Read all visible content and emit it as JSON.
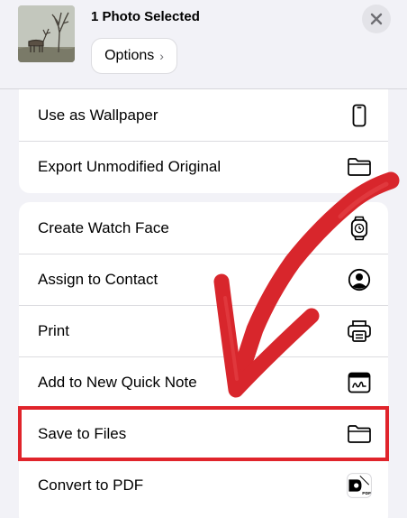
{
  "header": {
    "title": "1 Photo Selected",
    "options_label": "Options",
    "options_chevron": "›"
  },
  "menu_group_1": [
    {
      "label": "Use as Wallpaper",
      "icon": "phone-icon"
    },
    {
      "label": "Export Unmodified Original",
      "icon": "folder-icon"
    }
  ],
  "menu_group_2": [
    {
      "label": "Create Watch Face",
      "icon": "watch-icon"
    },
    {
      "label": "Assign to Contact",
      "icon": "contact-icon"
    },
    {
      "label": "Print",
      "icon": "printer-icon"
    },
    {
      "label": "Add to New Quick Note",
      "icon": "quick-note-icon"
    },
    {
      "label": "Save to Files",
      "icon": "folder-icon"
    },
    {
      "label": "Convert to PDF",
      "icon": "pdf-icon"
    }
  ],
  "annotation": {
    "highlighted_item": "Save to Files",
    "color": "#e0242b"
  },
  "colors": {
    "background": "#f2f2f7",
    "card": "#ffffff",
    "separator": "#dcdce0",
    "annotation_red": "#e0242b"
  }
}
